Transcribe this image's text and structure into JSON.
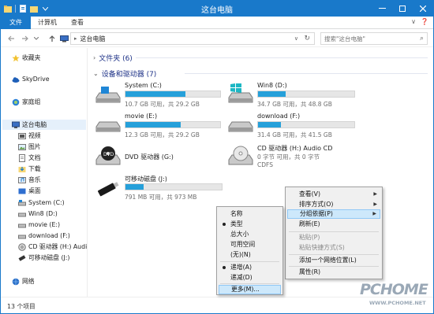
{
  "window": {
    "title": "这台电脑"
  },
  "ribbon": {
    "tabs": [
      "文件",
      "计算机",
      "查看"
    ]
  },
  "address": {
    "path": "这台电脑",
    "search_placeholder": "搜索\"这台电脑\""
  },
  "nav": {
    "favorites": "收藏夹",
    "skydrive": "SkyDrive",
    "homegroup": "家庭组",
    "thispc": "这台电脑",
    "children": [
      "视频",
      "图片",
      "文档",
      "下载",
      "音乐",
      "桌面",
      "System (C:)",
      "Win8 (D:)",
      "movie (E:)",
      "download (F:)",
      "CD 驱动器 (H:) Audi",
      "可移动磁盘 (J:)"
    ],
    "network": "网络"
  },
  "content": {
    "folders_group": "文件夹 (6)",
    "devices_group": "设备和驱动器 (7)",
    "drives": [
      {
        "name": "System (C:)",
        "free": "10.7 GB 可用，共 29.2 GB",
        "used_fraction": 0.63
      },
      {
        "name": "Win8 (D:)",
        "free": "34.7 GB 可用，共 48.8 GB",
        "used_fraction": 0.29
      },
      {
        "name": "movie (E:)",
        "free": "12.3 GB 可用，共 29.2 GB",
        "used_fraction": 0.58
      },
      {
        "name": "download (F:)",
        "free": "31.4 GB 可用，共 41.5 GB",
        "used_fraction": 0.24
      },
      {
        "name": "DVD 驱动器 (G:)",
        "free": ""
      },
      {
        "name": "CD 驱动器 (H:) Audio CD",
        "free": "0 字节 可用，共 0 字节",
        "fs": "CDFS"
      },
      {
        "name": "可移动磁盘 (J:)",
        "free": "791 MB 可用，共 973 MB",
        "used_fraction": 0.19
      }
    ]
  },
  "status": {
    "count": "13 个项目"
  },
  "context_menu": {
    "items": [
      "查看(V)",
      "排序方式(O)",
      "分组依据(P)",
      "刷新(E)",
      "粘贴(P)",
      "粘贴快捷方式(S)",
      "添加一个网络位置(L)",
      "属性(R)"
    ]
  },
  "submenu": {
    "items": [
      "名称",
      "类型",
      "总大小",
      "可用空间",
      "(无)(N)",
      "递增(A)",
      "递减(D)",
      "更多(M)..."
    ]
  },
  "watermark": {
    "brand": "PCHOME",
    "url": "WWW.PCHOME.NET"
  },
  "colors": {
    "accent": "#1979ca",
    "bar": "#26a0da",
    "group_text": "#1e3287"
  }
}
